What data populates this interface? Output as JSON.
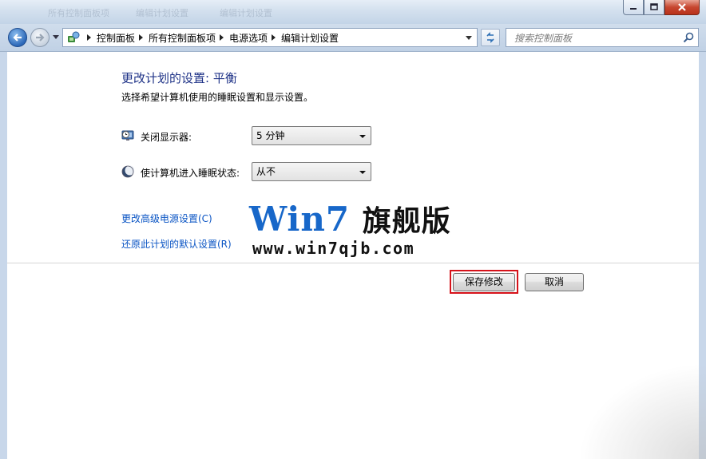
{
  "window": {
    "faded_title_fragments": [
      "编辑计划设置",
      "所有控制面板项",
      "编辑计划设置"
    ]
  },
  "address_bar": {
    "breadcrumbs": [
      "控制面板",
      "所有控制面板项",
      "电源选项",
      "编辑计划设置"
    ],
    "search_placeholder": "搜索控制面板"
  },
  "page": {
    "title": "更改计划的设置: 平衡",
    "subtitle": "选择希望计算机使用的睡眠设置和显示设置。"
  },
  "settings": [
    {
      "label": "关闭显示器:",
      "value": "5 分钟",
      "icon": "monitor-clock-icon"
    },
    {
      "label": "使计算机进入睡眠状态:",
      "value": "从不",
      "icon": "moon-sleep-icon"
    }
  ],
  "links": {
    "advanced": "更改高级电源设置(C)",
    "restore": "还原此计划的默认设置(R)"
  },
  "watermark": {
    "title_latin": "Win7",
    "title_cjk": "旗舰版",
    "url": "www.win7qjb.com"
  },
  "buttons": {
    "save": "保存修改",
    "cancel": "取消"
  },
  "colors": {
    "title_blue": "#1e3287",
    "link_blue": "#0b55c4",
    "highlight_red": "#d6121a",
    "watermark_blue": "#1767c9"
  }
}
